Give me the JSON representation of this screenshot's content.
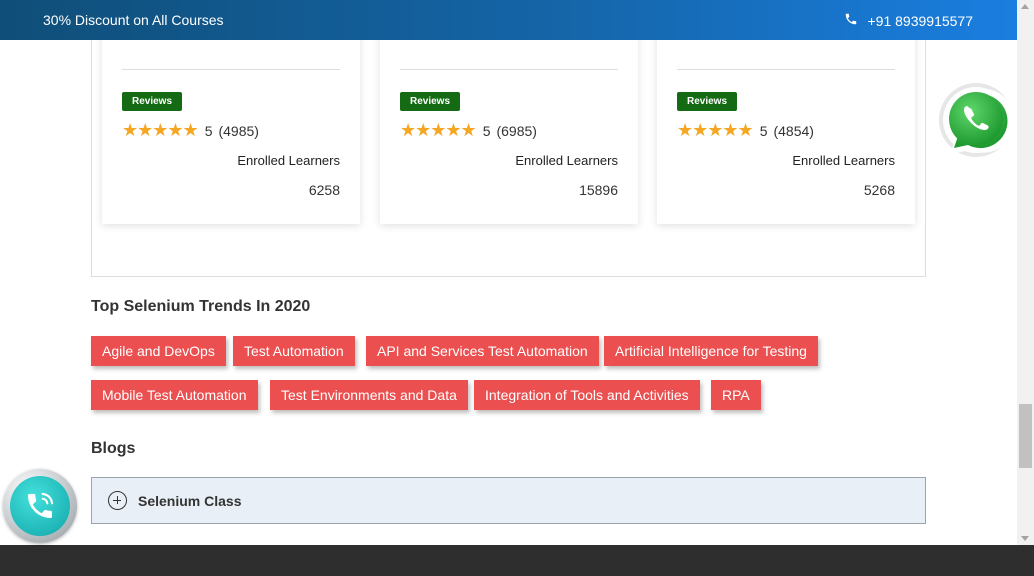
{
  "topbar": {
    "promo": "30% Discount on All Courses",
    "phone": "+91 8939915577"
  },
  "courses": [
    {
      "badge": "Reviews",
      "rating": "5",
      "reviews": "(4985)",
      "enrolled_label": "Enrolled Learners",
      "enrolled_count": "6258"
    },
    {
      "badge": "Reviews",
      "rating": "5",
      "reviews": "(6985)",
      "enrolled_label": "Enrolled Learners",
      "enrolled_count": "15896"
    },
    {
      "badge": "Reviews",
      "rating": "5",
      "reviews": "(4854)",
      "enrolled_label": "Enrolled Learners",
      "enrolled_count": "5268"
    }
  ],
  "trends": {
    "title": "Top Selenium Trends In 2020",
    "tags": [
      "Agile and DevOps",
      "Test Automation",
      "API and Services Test Automation",
      "Artificial Intelligence for Testing",
      "Mobile Test Automation",
      "Test Environments and Data",
      "Integration of Tools and Activities",
      "RPA"
    ]
  },
  "blogs": {
    "title": "Blogs",
    "items": [
      "Selenium Class"
    ]
  },
  "icons": {
    "phone": "phone-icon",
    "star": "star-icon",
    "plus": "plus-circle-icon",
    "whatsapp": "whatsapp-icon",
    "call": "call-icon"
  },
  "colors": {
    "topbar_start": "#0f4e78",
    "topbar_end": "#1a7ee0",
    "badge": "#146b14",
    "tag": "#eb4f4f",
    "star": "#f5a623",
    "accordion_bg": "#e9eff7",
    "footer": "#2e2e2e",
    "whatsapp": "#2fb344",
    "call": "#1fb7b8"
  }
}
